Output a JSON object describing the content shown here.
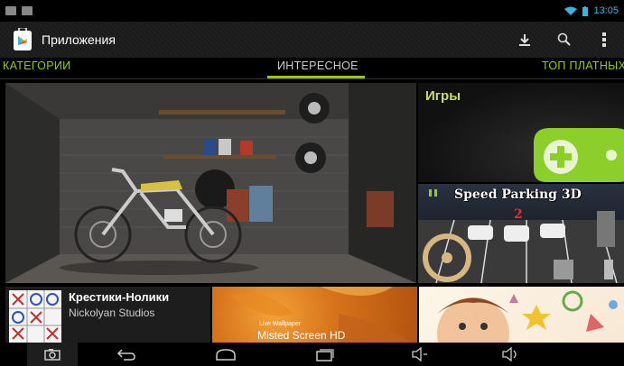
{
  "status_bar": {
    "time": "13:05"
  },
  "action_bar": {
    "title": "Приложения"
  },
  "tabs": [
    {
      "label": "КАТЕГОРИИ"
    },
    {
      "label": "ИНТЕРЕСНОЕ",
      "active": true
    },
    {
      "label": "ТОП ПЛАТНЫХ"
    }
  ],
  "tiles": {
    "games": {
      "label": "Игры"
    },
    "parking": {
      "title": "Speed Parking 3D"
    },
    "tictac": {
      "name": "Крестики-Нолики",
      "developer": "Nickolyan Studios"
    },
    "wallpaper": {
      "small": "Live Wallpaper",
      "big": "Misted Screen HD"
    }
  },
  "colors": {
    "accent": "#99cc00",
    "status_blue": "#33b5e5"
  }
}
